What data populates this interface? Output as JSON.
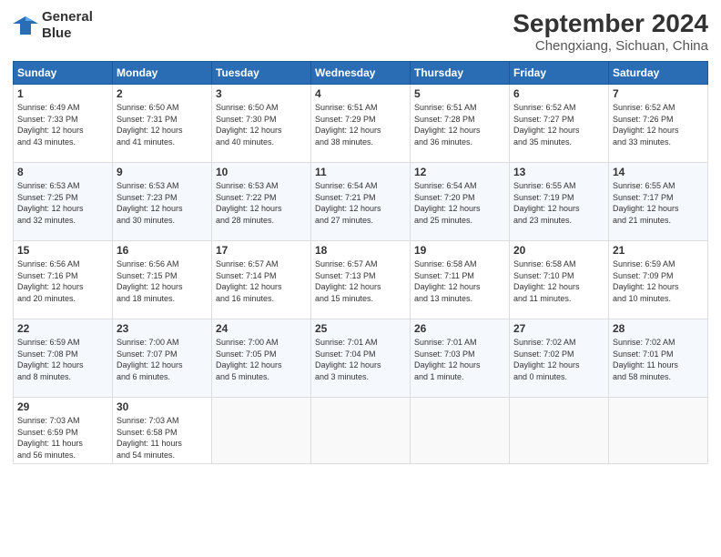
{
  "header": {
    "logo_line1": "General",
    "logo_line2": "Blue",
    "month": "September 2024",
    "location": "Chengxiang, Sichuan, China"
  },
  "weekdays": [
    "Sunday",
    "Monday",
    "Tuesday",
    "Wednesday",
    "Thursday",
    "Friday",
    "Saturday"
  ],
  "weeks": [
    [
      {
        "day": "1",
        "info": "Sunrise: 6:49 AM\nSunset: 7:33 PM\nDaylight: 12 hours\nand 43 minutes."
      },
      {
        "day": "2",
        "info": "Sunrise: 6:50 AM\nSunset: 7:31 PM\nDaylight: 12 hours\nand 41 minutes."
      },
      {
        "day": "3",
        "info": "Sunrise: 6:50 AM\nSunset: 7:30 PM\nDaylight: 12 hours\nand 40 minutes."
      },
      {
        "day": "4",
        "info": "Sunrise: 6:51 AM\nSunset: 7:29 PM\nDaylight: 12 hours\nand 38 minutes."
      },
      {
        "day": "5",
        "info": "Sunrise: 6:51 AM\nSunset: 7:28 PM\nDaylight: 12 hours\nand 36 minutes."
      },
      {
        "day": "6",
        "info": "Sunrise: 6:52 AM\nSunset: 7:27 PM\nDaylight: 12 hours\nand 35 minutes."
      },
      {
        "day": "7",
        "info": "Sunrise: 6:52 AM\nSunset: 7:26 PM\nDaylight: 12 hours\nand 33 minutes."
      }
    ],
    [
      {
        "day": "8",
        "info": "Sunrise: 6:53 AM\nSunset: 7:25 PM\nDaylight: 12 hours\nand 32 minutes."
      },
      {
        "day": "9",
        "info": "Sunrise: 6:53 AM\nSunset: 7:23 PM\nDaylight: 12 hours\nand 30 minutes."
      },
      {
        "day": "10",
        "info": "Sunrise: 6:53 AM\nSunset: 7:22 PM\nDaylight: 12 hours\nand 28 minutes."
      },
      {
        "day": "11",
        "info": "Sunrise: 6:54 AM\nSunset: 7:21 PM\nDaylight: 12 hours\nand 27 minutes."
      },
      {
        "day": "12",
        "info": "Sunrise: 6:54 AM\nSunset: 7:20 PM\nDaylight: 12 hours\nand 25 minutes."
      },
      {
        "day": "13",
        "info": "Sunrise: 6:55 AM\nSunset: 7:19 PM\nDaylight: 12 hours\nand 23 minutes."
      },
      {
        "day": "14",
        "info": "Sunrise: 6:55 AM\nSunset: 7:17 PM\nDaylight: 12 hours\nand 21 minutes."
      }
    ],
    [
      {
        "day": "15",
        "info": "Sunrise: 6:56 AM\nSunset: 7:16 PM\nDaylight: 12 hours\nand 20 minutes."
      },
      {
        "day": "16",
        "info": "Sunrise: 6:56 AM\nSunset: 7:15 PM\nDaylight: 12 hours\nand 18 minutes."
      },
      {
        "day": "17",
        "info": "Sunrise: 6:57 AM\nSunset: 7:14 PM\nDaylight: 12 hours\nand 16 minutes."
      },
      {
        "day": "18",
        "info": "Sunrise: 6:57 AM\nSunset: 7:13 PM\nDaylight: 12 hours\nand 15 minutes."
      },
      {
        "day": "19",
        "info": "Sunrise: 6:58 AM\nSunset: 7:11 PM\nDaylight: 12 hours\nand 13 minutes."
      },
      {
        "day": "20",
        "info": "Sunrise: 6:58 AM\nSunset: 7:10 PM\nDaylight: 12 hours\nand 11 minutes."
      },
      {
        "day": "21",
        "info": "Sunrise: 6:59 AM\nSunset: 7:09 PM\nDaylight: 12 hours\nand 10 minutes."
      }
    ],
    [
      {
        "day": "22",
        "info": "Sunrise: 6:59 AM\nSunset: 7:08 PM\nDaylight: 12 hours\nand 8 minutes."
      },
      {
        "day": "23",
        "info": "Sunrise: 7:00 AM\nSunset: 7:07 PM\nDaylight: 12 hours\nand 6 minutes."
      },
      {
        "day": "24",
        "info": "Sunrise: 7:00 AM\nSunset: 7:05 PM\nDaylight: 12 hours\nand 5 minutes."
      },
      {
        "day": "25",
        "info": "Sunrise: 7:01 AM\nSunset: 7:04 PM\nDaylight: 12 hours\nand 3 minutes."
      },
      {
        "day": "26",
        "info": "Sunrise: 7:01 AM\nSunset: 7:03 PM\nDaylight: 12 hours\nand 1 minute."
      },
      {
        "day": "27",
        "info": "Sunrise: 7:02 AM\nSunset: 7:02 PM\nDaylight: 12 hours\nand 0 minutes."
      },
      {
        "day": "28",
        "info": "Sunrise: 7:02 AM\nSunset: 7:01 PM\nDaylight: 11 hours\nand 58 minutes."
      }
    ],
    [
      {
        "day": "29",
        "info": "Sunrise: 7:03 AM\nSunset: 6:59 PM\nDaylight: 11 hours\nand 56 minutes."
      },
      {
        "day": "30",
        "info": "Sunrise: 7:03 AM\nSunset: 6:58 PM\nDaylight: 11 hours\nand 54 minutes."
      },
      null,
      null,
      null,
      null,
      null
    ]
  ]
}
